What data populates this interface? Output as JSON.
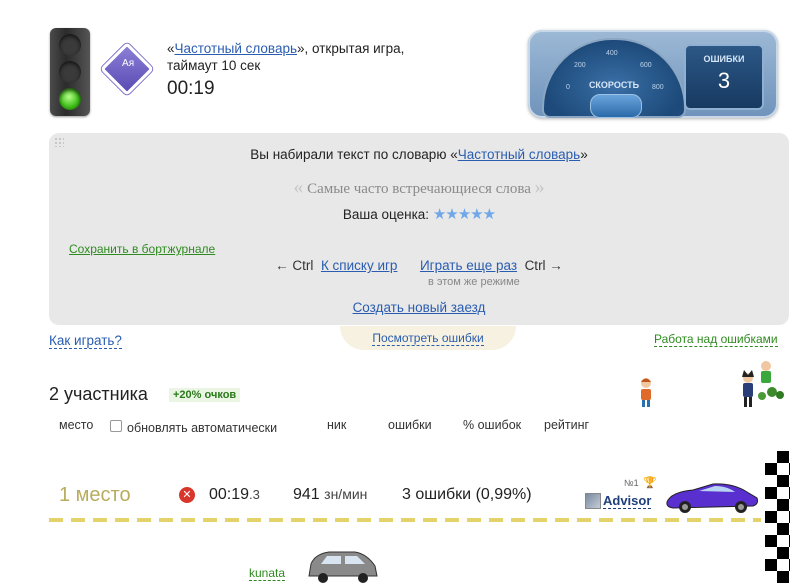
{
  "header": {
    "dict_open_quote": "«",
    "dict_name": "Частотный словарь",
    "dict_suffix": "», открытая игра,",
    "timeout_text": "таймаут 10 сек",
    "timer": "00:19"
  },
  "speedometer": {
    "label": "СКОРОСТЬ",
    "ticks": [
      "0",
      "200",
      "400",
      "600",
      "800"
    ],
    "errors_label": "ОШИБКИ",
    "errors_value": "3"
  },
  "result": {
    "typed_prefix": "Вы набирали текст по словарю «",
    "typed_dict": "Частотный словарь",
    "typed_suffix": "»",
    "quote_open": "«",
    "quote_title": "Самые часто встречающиеся слова",
    "quote_close": "»",
    "rating_label": "Ваша оценка:",
    "rating_stars": 5,
    "save_link": "Сохранить в бортжурнале",
    "ctrl_left": "← Ctrl",
    "to_games": "К списку игр",
    "play_again": "Играть еще раз",
    "ctrl_right": "Ctrl →",
    "same_mode": "в этом же режиме",
    "new_race": "Создать новый заезд"
  },
  "links": {
    "how_to_play": "Как играть?",
    "view_errors": "Посмотреть ошибки",
    "work_errors": "Работа над ошибками"
  },
  "participants": {
    "title": "2 участника",
    "bonus": "+20% очков",
    "columns": {
      "place": "место",
      "auto_update": "обновлять автоматически",
      "nick": "ник",
      "errors": "ошибки",
      "pct_errors": "% ошибок",
      "rating": "рейтинг"
    }
  },
  "race": [
    {
      "place": "1 место",
      "time_main": "00:19",
      "time_fraction": ".3",
      "speed": "941",
      "speed_unit": "зн/мин",
      "errors": "3 ошибки (0,99%)",
      "rank_no": "№1",
      "nick": "Advisor",
      "car_color": "#5a2fd0"
    },
    {
      "nick": "kunata",
      "car_color": "#8a8a8a"
    }
  ]
}
